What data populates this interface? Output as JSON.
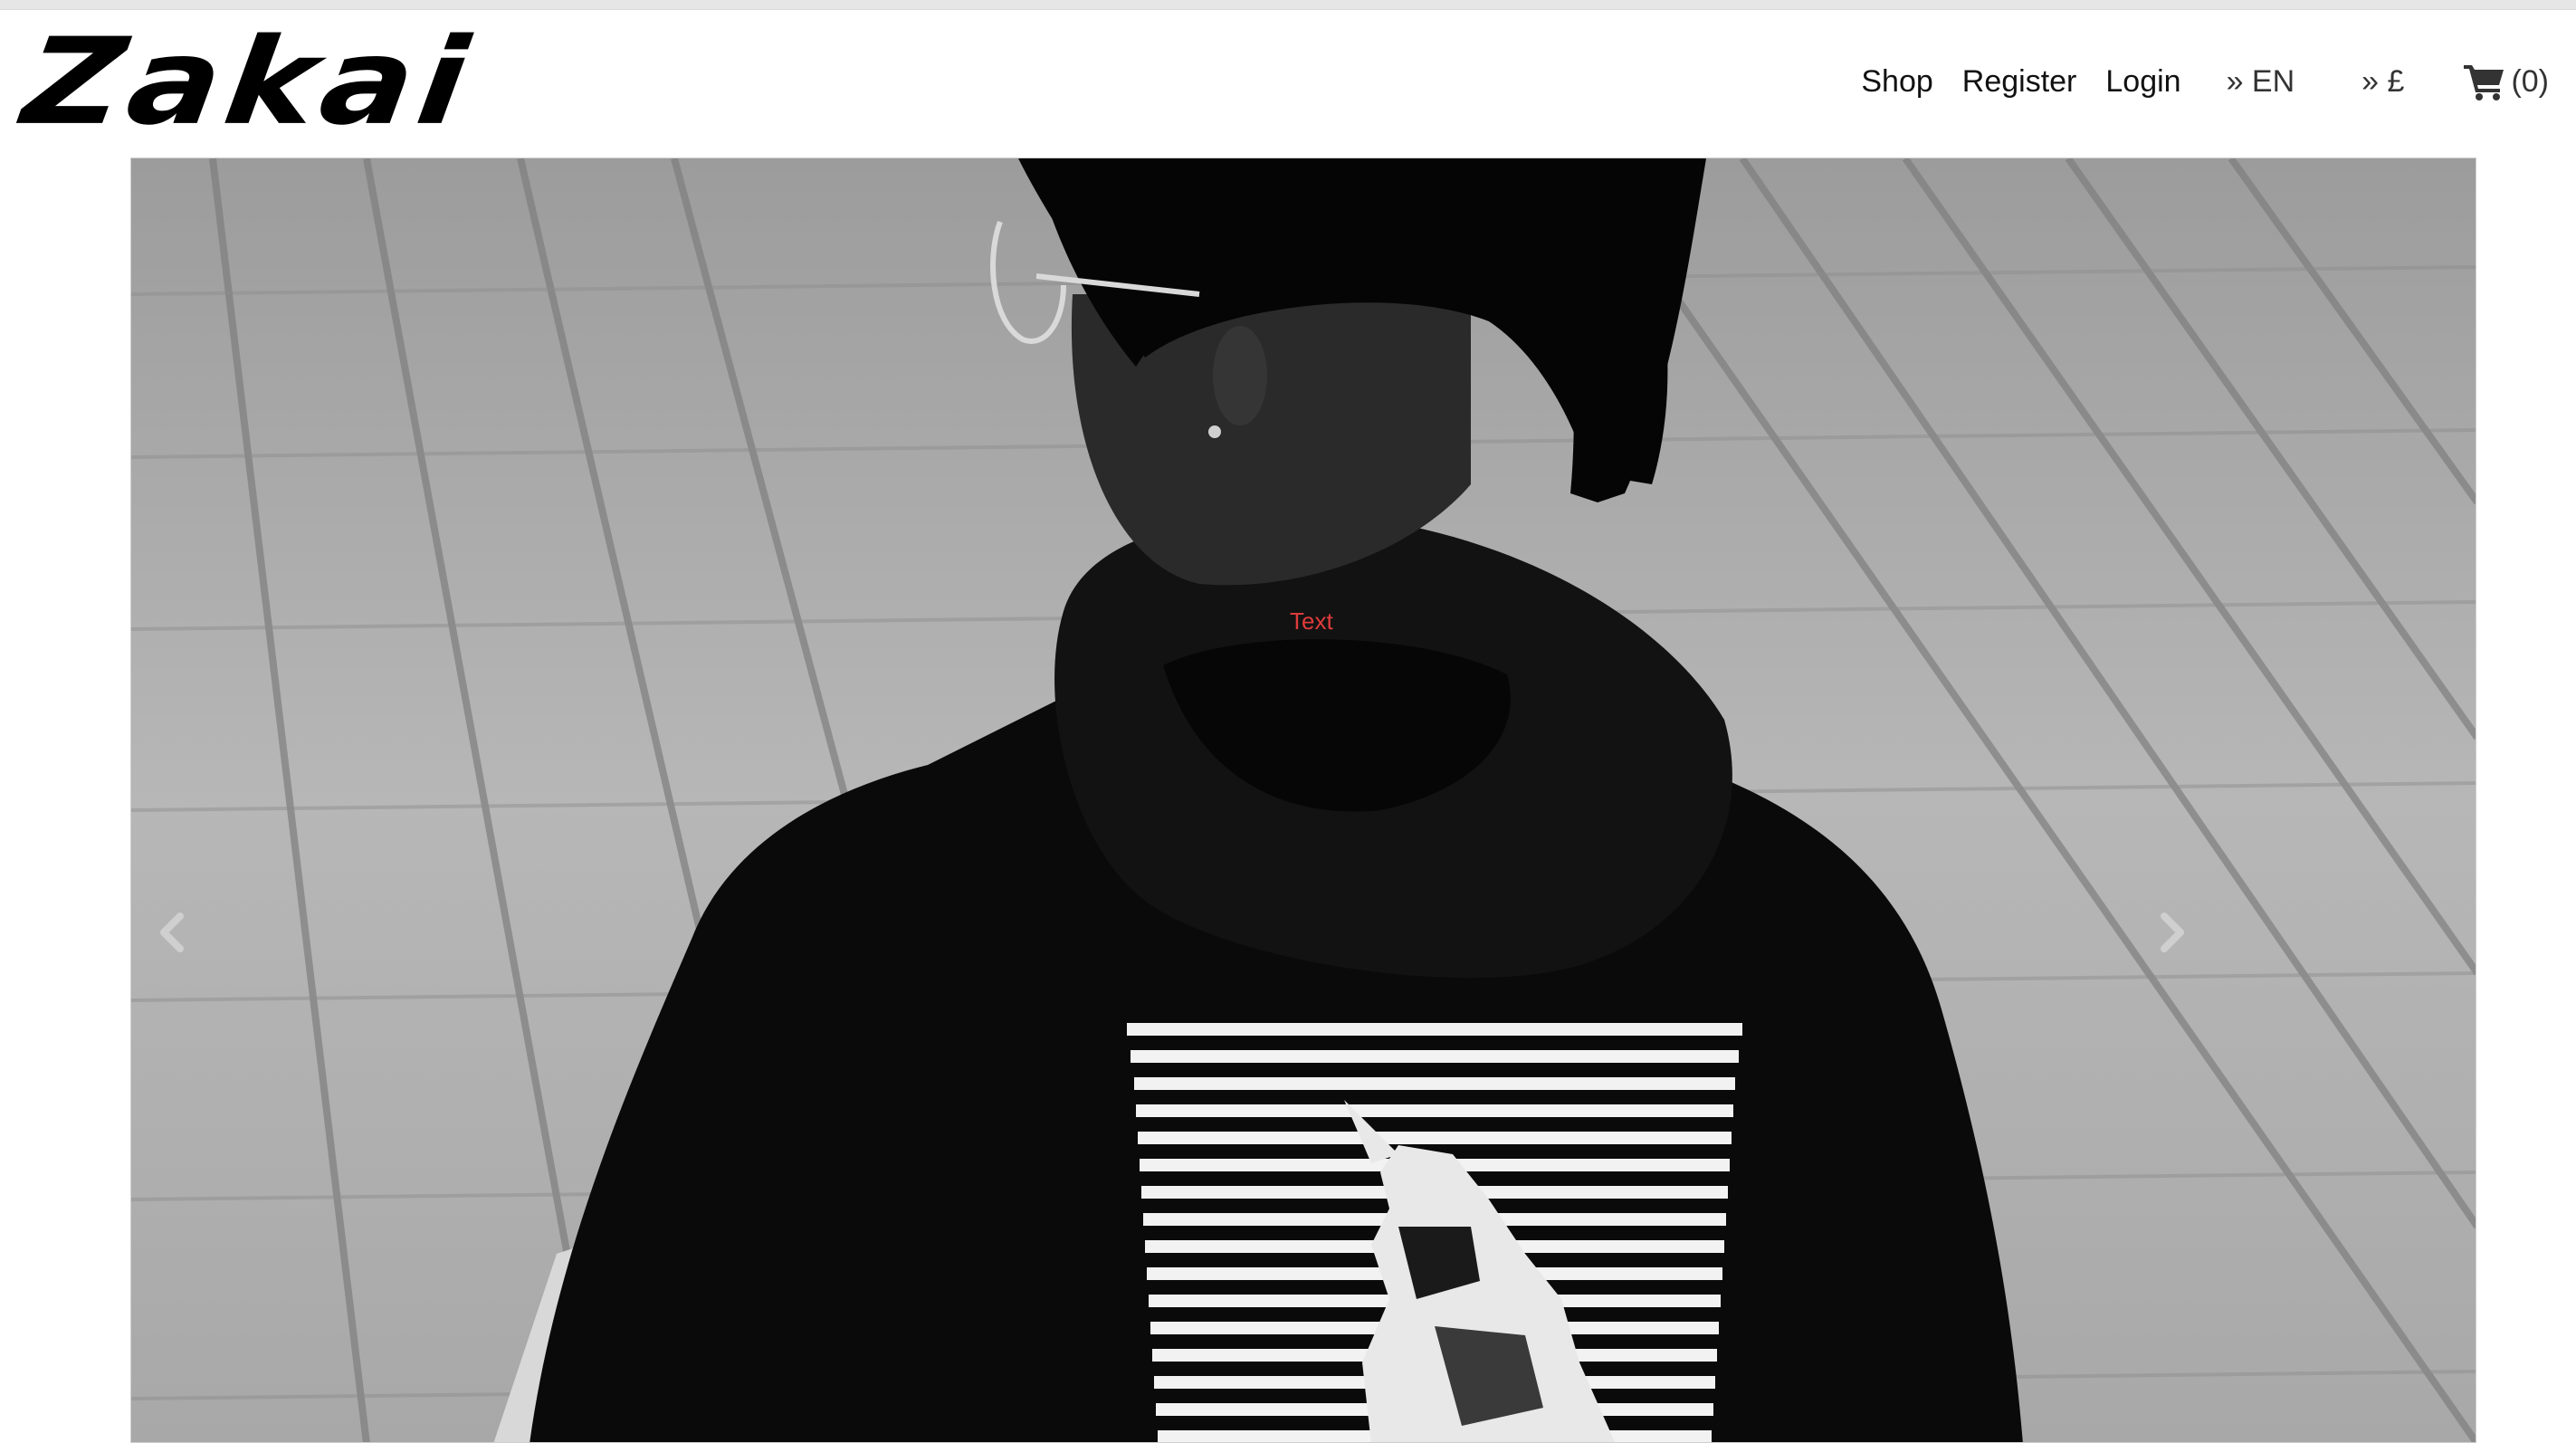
{
  "brand": {
    "logo_text": "Zakai"
  },
  "nav": {
    "links": [
      "Shop",
      "Register",
      "Login"
    ],
    "language": "» EN",
    "currency": "» £",
    "cart_count": "(0)"
  },
  "hero": {
    "caption": "Text"
  },
  "icons": {
    "cart": "shopping-cart-icon",
    "prev": "chevron-left-icon",
    "next": "chevron-right-icon"
  },
  "colors": {
    "caption": "#e03b3b",
    "text": "#111111"
  }
}
